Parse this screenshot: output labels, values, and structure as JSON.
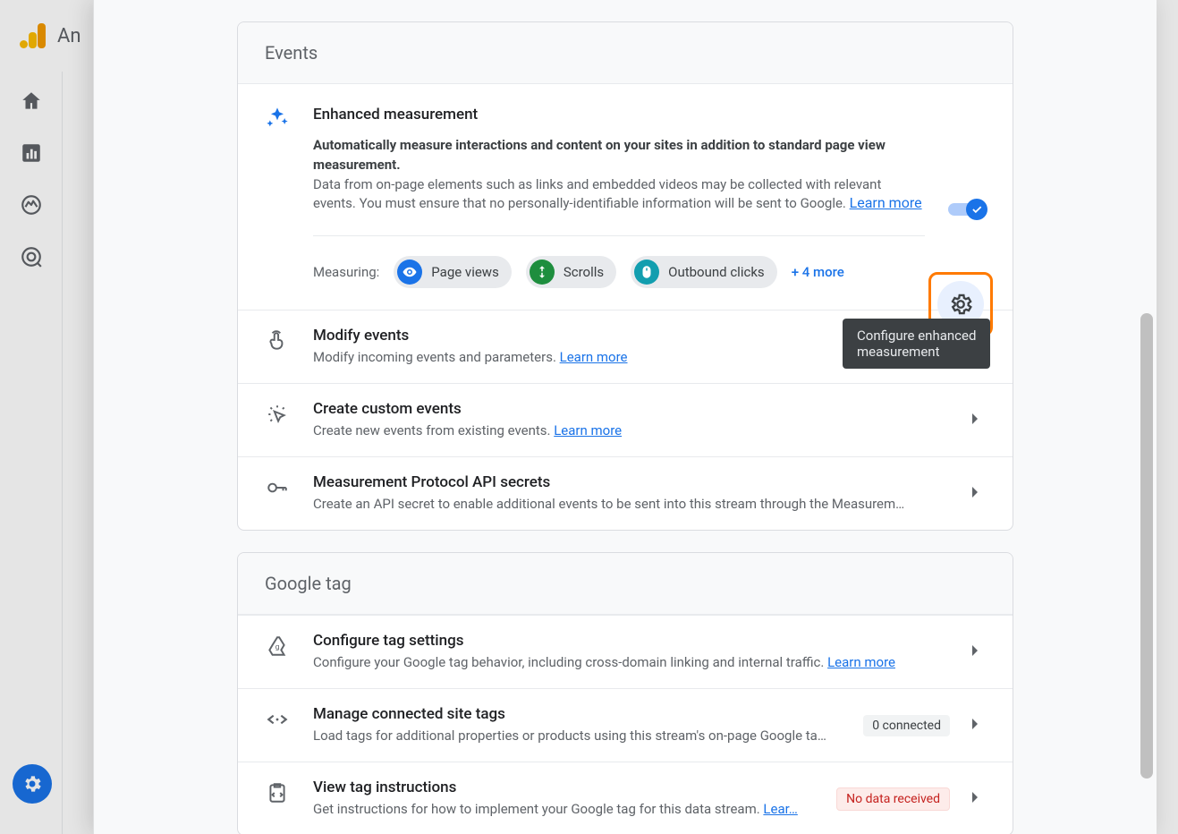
{
  "app_title": "An",
  "cards": {
    "events": {
      "header": "Events",
      "enhanced": {
        "title": "Enhanced measurement",
        "strong": "Automatically measure interactions and content on your sites in addition to standard page view measurement.",
        "text": "Data from on-page elements such as links and embedded videos may be collected with relevant events. You must ensure that no personally-identifiable information will be sent to Google. ",
        "learn": "Learn more",
        "measuring_label": "Measuring:",
        "pills": [
          {
            "label": "Page views"
          },
          {
            "label": "Scrolls"
          },
          {
            "label": "Outbound clicks"
          }
        ],
        "more": "+ 4 more",
        "gear_tooltip": "Configure enhanced\nmeasurement"
      },
      "rows": [
        {
          "title": "Modify events",
          "desc": "Modify incoming events and parameters. ",
          "learn": "Learn more"
        },
        {
          "title": "Create custom events",
          "desc": "Create new events from existing events. ",
          "learn": "Learn more"
        },
        {
          "title": "Measurement Protocol API secrets",
          "desc": "Create an API secret to enable additional events to be sent into this stream through the Measurem…",
          "learn": ""
        }
      ]
    },
    "gtag": {
      "header": "Google tag",
      "rows": [
        {
          "title": "Configure tag settings",
          "desc": "Configure your Google tag behavior, including cross-domain linking and internal traffic. ",
          "learn": "Learn more",
          "badge": "",
          "badge_kind": ""
        },
        {
          "title": "Manage connected site tags",
          "desc": "Load tags for additional properties or products using this stream's on-page Google ta…",
          "learn": "",
          "badge": "0 connected",
          "badge_kind": "plain"
        },
        {
          "title": "View tag instructions",
          "desc": "Get instructions for how to implement your Google tag for this data stream. ",
          "learn": "Lear…",
          "badge": "No data received",
          "badge_kind": "warn"
        }
      ]
    }
  }
}
